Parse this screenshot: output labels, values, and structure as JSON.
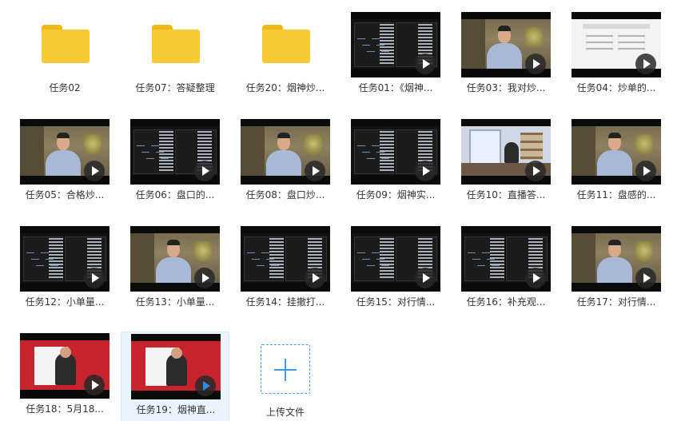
{
  "items": [
    {
      "label": "任务02",
      "type": "folder"
    },
    {
      "label": "任务07：答疑整理",
      "type": "folder"
    },
    {
      "label": "任务20：烟神炒...",
      "type": "folder"
    },
    {
      "label": "任务01：《烟神...",
      "type": "video",
      "scene": "trade"
    },
    {
      "label": "任务03：我对炒...",
      "type": "video",
      "scene": "person"
    },
    {
      "label": "任务04：炒单的...",
      "type": "video",
      "scene": "doc"
    },
    {
      "label": "任务05：合格炒...",
      "type": "video",
      "scene": "person"
    },
    {
      "label": "任务06：盘口的...",
      "type": "video",
      "scene": "trade"
    },
    {
      "label": "任务08：盘口炒...",
      "type": "video",
      "scene": "person"
    },
    {
      "label": "任务09：烟神实...",
      "type": "video",
      "scene": "trade"
    },
    {
      "label": "任务10：直播答...",
      "type": "video",
      "scene": "office"
    },
    {
      "label": "任务11：盘感的...",
      "type": "video",
      "scene": "person"
    },
    {
      "label": "任务12：小单量...",
      "type": "video",
      "scene": "trade"
    },
    {
      "label": "任务13：小单量...",
      "type": "video",
      "scene": "person"
    },
    {
      "label": "任务14：挂撤打...",
      "type": "video",
      "scene": "trade"
    },
    {
      "label": "任务15：对行情...",
      "type": "video",
      "scene": "trade"
    },
    {
      "label": "任务16：补充观...",
      "type": "video",
      "scene": "trade"
    },
    {
      "label": "任务17：对行情...",
      "type": "video",
      "scene": "person"
    },
    {
      "label": "任务18：5月18...",
      "type": "video",
      "scene": "red"
    },
    {
      "label": "任务19：烟神直...",
      "type": "video",
      "scene": "red",
      "selected": true
    },
    {
      "label": "上传文件",
      "type": "upload"
    }
  ]
}
